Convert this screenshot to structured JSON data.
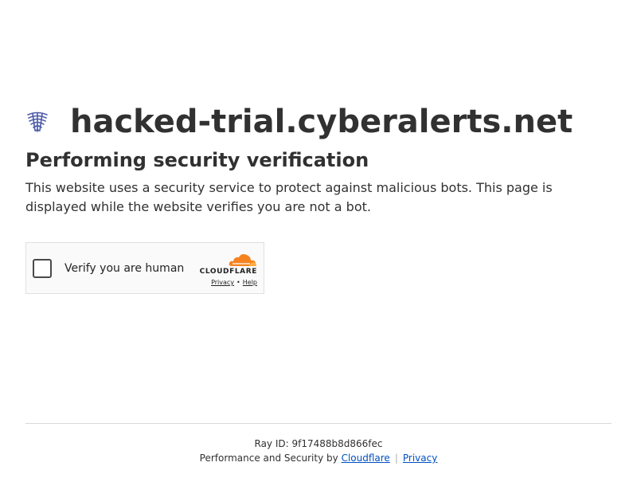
{
  "site": {
    "domain": "hacked-trial.cyberalerts.net",
    "logo_icon": "shield-logo-icon"
  },
  "main": {
    "heading": "Performing security verification",
    "description": "This website uses a security service to protect against malicious bots. This page is displayed while the website verifies you are not a bot."
  },
  "challenge": {
    "checkbox_label": "Verify you are human",
    "checked": false,
    "brand_name": "CLOUDFLARE",
    "privacy_link": "Privacy",
    "separator": "•",
    "help_link": "Help"
  },
  "footer": {
    "ray_id": "Ray ID: 9f17488b8d866fec",
    "credits_prefix": "Performance and Security by",
    "cloudflare_link": "Cloudflare",
    "separator": "|",
    "privacy_link": "Privacy"
  },
  "colors": {
    "text": "#313131",
    "link": "#0051c3",
    "cloudflare_orange": "#f6821f",
    "cloudflare_light_orange": "#fbad41",
    "logo_blue": "#4b5aa8"
  }
}
